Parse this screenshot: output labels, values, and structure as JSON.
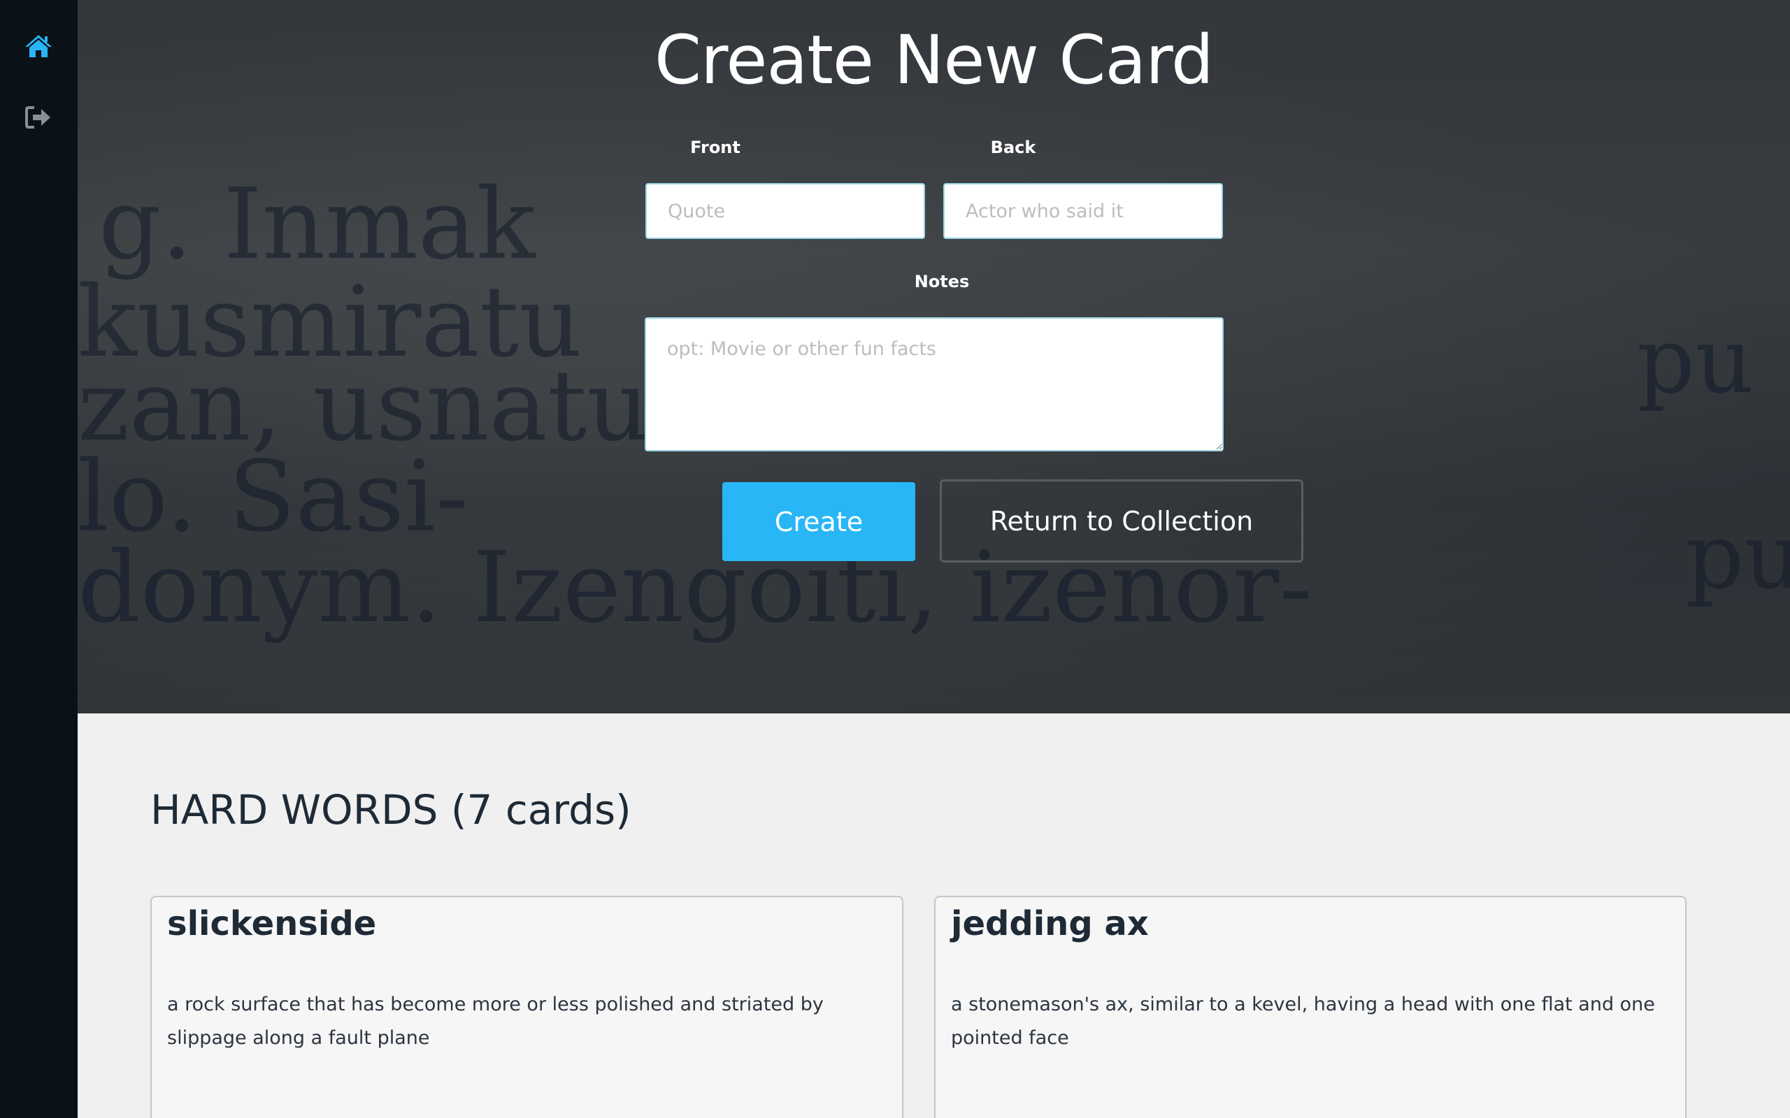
{
  "sidebar": {
    "items": [
      {
        "icon": "home-icon",
        "color": "#28b6f6"
      },
      {
        "icon": "sign-out-icon",
        "color": "#8a8f94"
      }
    ]
  },
  "form": {
    "title": "Create New Card",
    "front_label": "Front",
    "front_placeholder": "Quote",
    "back_label": "Back",
    "back_placeholder": "Actor who said it",
    "notes_label": "Notes",
    "notes_placeholder": "opt: Movie or other fun facts",
    "create_label": "Create",
    "return_label": "Return to Collection"
  },
  "collection": {
    "title": "HARD WORDS (7 cards)",
    "cards": [
      {
        "front": "slickenside",
        "back": "a rock surface that has become more or less polished and striated by slippage along a fault plane"
      },
      {
        "front": "jedding ax",
        "back": "a stonemason's ax, similar to a kevel, having a head with one flat and one pointed face"
      }
    ]
  },
  "colors": {
    "accent": "#28b6f6",
    "sidebar": "#0b1217",
    "page_bg": "#f0f0f0",
    "heading": "#1e2a36"
  }
}
